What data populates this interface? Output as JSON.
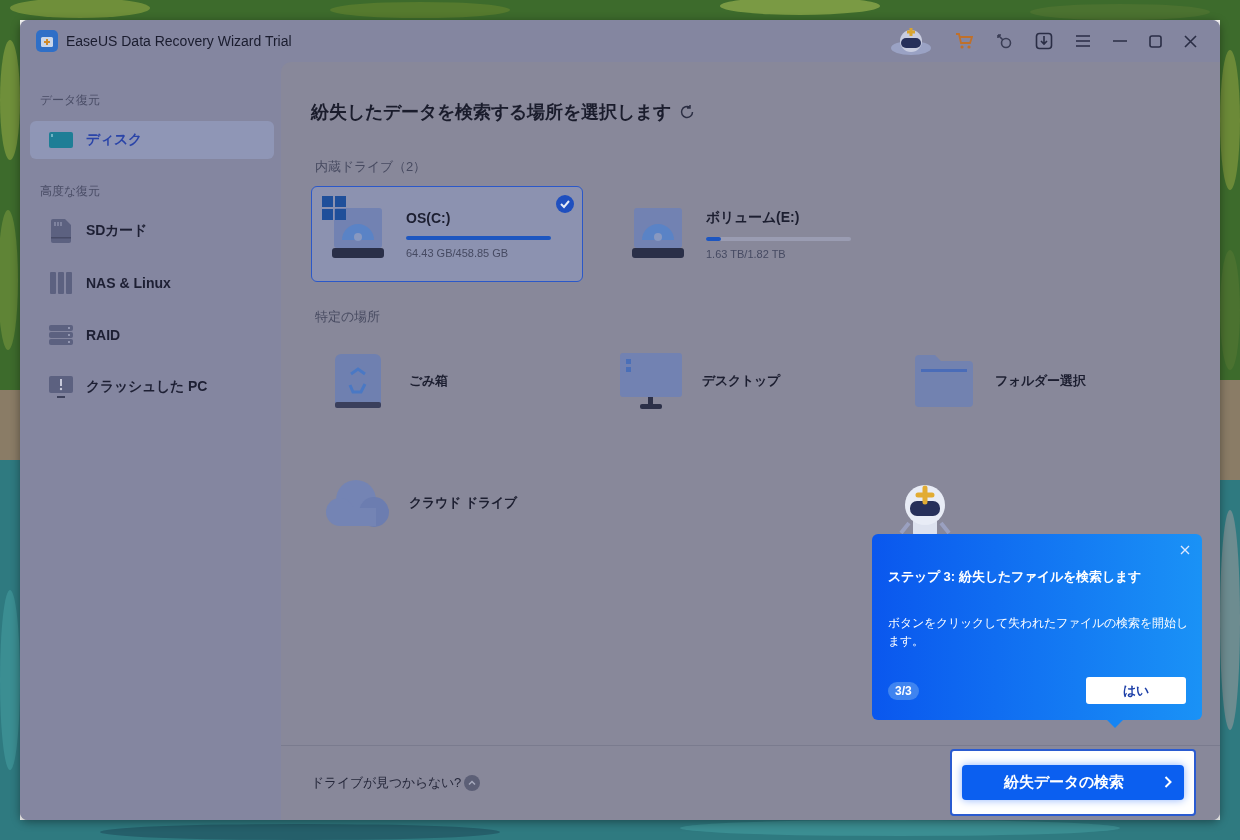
{
  "window": {
    "title": "EaseUS Data Recovery Wizard Trial"
  },
  "sidebar": {
    "sections": [
      {
        "heading": "データ復元",
        "items": [
          {
            "label": "ディスク",
            "kind": "disk",
            "selected": true
          }
        ]
      },
      {
        "heading": "高度な復元",
        "items": [
          {
            "label": "SDカード",
            "kind": "sd",
            "selected": false
          },
          {
            "label": "NAS & Linux",
            "kind": "nas",
            "selected": false
          },
          {
            "label": "RAID",
            "kind": "raid",
            "selected": false
          },
          {
            "label": "クラッシュした PC",
            "kind": "crash",
            "selected": false
          }
        ]
      }
    ]
  },
  "main": {
    "title": "紛失したデータを検索する場所を選択します",
    "drives_heading": "内蔵ドライブ（2）",
    "drives": [
      {
        "name": "OS(C:)",
        "usage": "64.43 GB/458.85 GB",
        "level": 1.0,
        "selected": true,
        "system": true
      },
      {
        "name": "ボリューム(E:)",
        "usage": "1.63 TB/1.82 TB",
        "level": 0.1,
        "selected": false,
        "system": false
      }
    ],
    "locations_heading": "特定の場所",
    "locations": [
      {
        "label": "ごみ箱",
        "kind": "trash"
      },
      {
        "label": "デスクトップ",
        "kind": "desktop"
      },
      {
        "label": "フォルダー選択",
        "kind": "folder"
      },
      {
        "label": "クラウド ドライブ",
        "kind": "cloud"
      }
    ],
    "footer": {
      "link": "ドライブが見つからない?",
      "scan_button": "紛失データの検索"
    }
  },
  "tour": {
    "title": "ステップ 3: 紛失したファイルを検索します",
    "body": "ボタンをクリックして失われたファイルの検索を開始します。",
    "step": "3/3",
    "ok": "はい"
  }
}
